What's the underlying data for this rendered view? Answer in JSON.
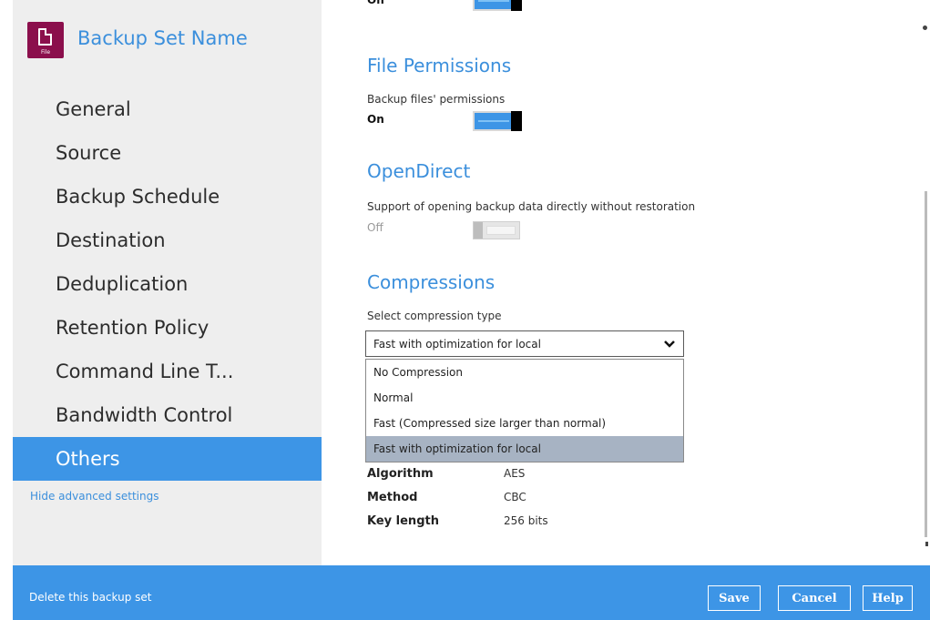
{
  "sidebar": {
    "icon": {
      "name": "file-icon",
      "tag": "File",
      "color": "#8b0f4c"
    },
    "title": "Backup Set Name",
    "items": [
      {
        "label": "General"
      },
      {
        "label": "Source"
      },
      {
        "label": "Backup Schedule"
      },
      {
        "label": "Destination"
      },
      {
        "label": "Deduplication"
      },
      {
        "label": "Retention Policy"
      },
      {
        "label": "Command Line T..."
      },
      {
        "label": "Bandwidth Control"
      },
      {
        "label": "Others",
        "active": true
      }
    ],
    "advanced_link": "Hide advanced settings"
  },
  "main": {
    "top_partial": {
      "state": "On"
    },
    "file_permissions": {
      "title": "File Permissions",
      "description": "Backup files' permissions",
      "state": "On"
    },
    "open_direct": {
      "title": "OpenDirect",
      "description": "Support of opening backup data directly without restoration",
      "state": "Off"
    },
    "compressions": {
      "title": "Compressions",
      "description": "Select compression type",
      "selected": "Fast with optimization for local",
      "options": [
        "No Compression",
        "Normal",
        "Fast (Compressed size larger than normal)",
        "Fast with optimization for local"
      ]
    },
    "encryption": {
      "rows": [
        {
          "key": "Algorithm",
          "value": "AES"
        },
        {
          "key": "Method",
          "value": "CBC"
        },
        {
          "key": "Key length",
          "value": "256 bits"
        }
      ]
    }
  },
  "footer": {
    "delete_link": "Delete this backup set",
    "save": "Save",
    "cancel": "Cancel",
    "help": "Help"
  },
  "colors": {
    "accent": "#3d95e6",
    "link": "#3b8fdc",
    "sidebar_bg": "#eeeeee",
    "dropdown_selected": "#a7b3c3"
  }
}
